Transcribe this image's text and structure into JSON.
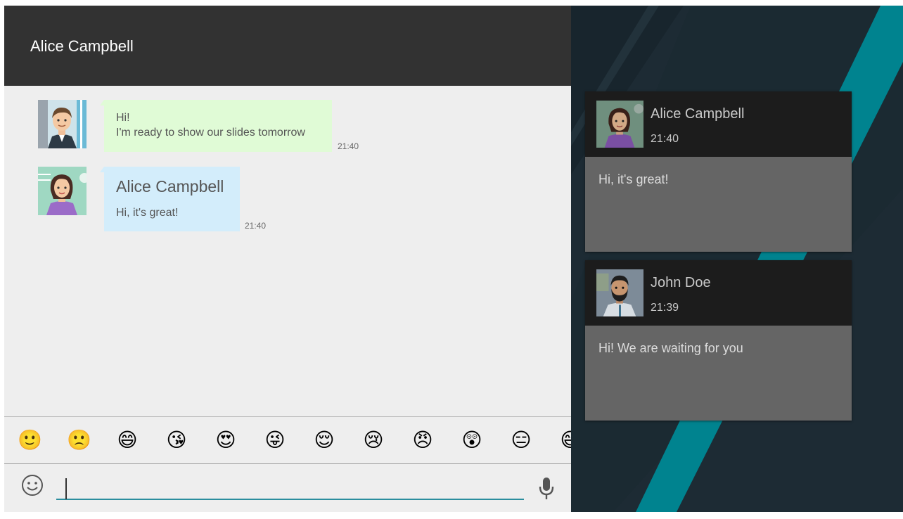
{
  "chat": {
    "title": "Alice Campbell",
    "messages": [
      {
        "lines": [
          "Hi!",
          "I'm ready to show our slides tomorrow"
        ],
        "time": "21:40",
        "avatar_icon": "man-avatar-icon",
        "bubble_color": "#e0fbd6"
      },
      {
        "sender": "Alice Campbell",
        "text": "Hi, it's great!",
        "time": "21:40",
        "avatar_icon": "woman-avatar-icon",
        "bubble_color": "#d3edfb"
      }
    ],
    "emojis": [
      "🙂",
      "🙁",
      "😄",
      "😘",
      "😍",
      "😜",
      "😌",
      "😢",
      "😠",
      "😲",
      "😑",
      "😅"
    ],
    "input": {
      "value": "",
      "placeholder": ""
    },
    "icons": {
      "emoji_toggle": "smiley-icon",
      "mic": "microphone-icon"
    }
  },
  "notifications": [
    {
      "name": "Alice Campbell",
      "time": "21:40",
      "text": "Hi, it's great!",
      "avatar_icon": "woman-avatar-icon"
    },
    {
      "name": "John Doe",
      "time": "21:39",
      "text": "Hi! We are waiting for you",
      "avatar_icon": "bearded-man-avatar-icon"
    }
  ],
  "colors": {
    "header": "#323232",
    "accent": "#2b8e9e",
    "notif_background": "#1d2b34",
    "teal_stripe": "#00838f"
  }
}
